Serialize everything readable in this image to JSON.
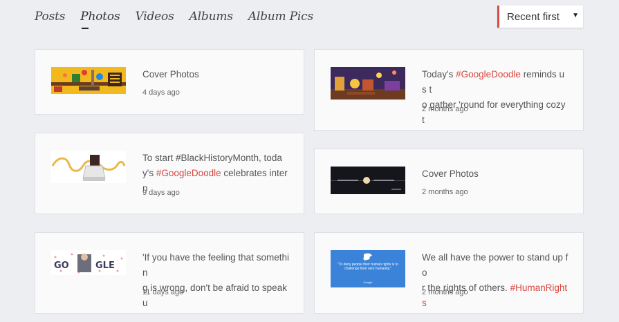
{
  "tabs": [
    {
      "label": "Posts"
    },
    {
      "label": "Photos"
    },
    {
      "label": "Videos"
    },
    {
      "label": "Albums"
    },
    {
      "label": "Album Pics"
    }
  ],
  "sort": {
    "label": "Recent first",
    "caret": "▼"
  },
  "cards": [
    {
      "line1": "Cover Photos",
      "line2": "",
      "time": "4 days ago",
      "thumb_icon": "doodle-workshop-image"
    },
    {
      "line1_pre": "Today's ",
      "line1_tag": "#GoogleDoodle",
      "line1_post": " reminds us t",
      "line2": "o gather 'round for everything cozy t",
      "time": "2 months ago",
      "thumb_icon": "doodle-cozy-room-image"
    },
    {
      "line1": "To start #BlackHistoryMonth, toda",
      "line2_pre": "y's ",
      "line2_tag": "#GoogleDoodle",
      "line2_post": " celebrates intern",
      "time": "9 days ago",
      "thumb_icon": "doodle-ribbon-image"
    },
    {
      "line1": "Cover Photos",
      "line2": "",
      "time": "2 months ago",
      "thumb_icon": "night-cover-image"
    },
    {
      "line1": "'If you have the feeling that somethin",
      "line2": "g is wrong, don't be afraid to speak u",
      "time": "11 days ago",
      "thumb_icon": "doodle-portrait-image"
    },
    {
      "line1": "We all have the power to stand up fo",
      "line2_pre": "r the rights of others. ",
      "line2_tag": "#HumanRights",
      "time": "2 months ago",
      "thumb_icon": "human-rights-dove-image",
      "thumb_quote": "\"To deny people their human rights is to challenge their very humanity.\"",
      "thumb_brand": "Google"
    }
  ],
  "colors": {
    "accent": "#d94b45",
    "hashtag": "#d9463e",
    "background": "#eceef1"
  }
}
